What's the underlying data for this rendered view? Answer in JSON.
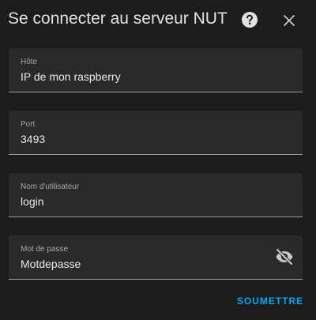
{
  "dialog": {
    "title": "Se connecter au serveur NUT",
    "help_icon": "help-circle-icon",
    "close_icon": "close-icon"
  },
  "fields": {
    "host": {
      "label": "Hôte",
      "value": "IP de mon raspberry"
    },
    "port": {
      "label": "Port",
      "value": "3493"
    },
    "username": {
      "label": "Nom d'utilisateur",
      "value": "login"
    },
    "password": {
      "label": "Mot de passe",
      "value": "Motdepasse",
      "toggle_icon": "eye-off-icon"
    }
  },
  "actions": {
    "submit_label": "SOUMETTRE"
  },
  "colors": {
    "background": "#1c1c1c",
    "field_background": "#2a2a2a",
    "accent": "#03a9f4",
    "text": "#e1e1e1"
  }
}
